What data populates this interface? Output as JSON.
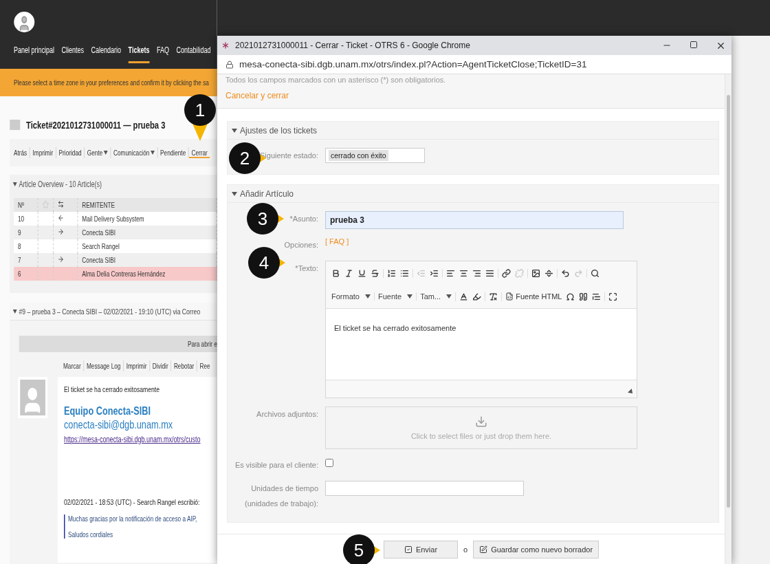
{
  "app": {
    "nav": [
      {
        "label": "Panel principal",
        "selected": false
      },
      {
        "label": "Clientes",
        "selected": false
      },
      {
        "label": "Calendario",
        "selected": false
      },
      {
        "label": "Tickets",
        "selected": true
      },
      {
        "label": "FAQ",
        "selected": false
      },
      {
        "label": "Contabilidad",
        "selected": false
      }
    ],
    "banner": "Please select a time zone in your preferences and confirm it by clicking the sa",
    "ticket_title": "Ticket#2021012731000011 — prueba 3",
    "actions": [
      {
        "label": "Atrás",
        "has_menu": false,
        "selected": false
      },
      {
        "label": "Imprimir",
        "has_menu": false,
        "selected": false
      },
      {
        "label": "Prioridad",
        "has_menu": false,
        "selected": false
      },
      {
        "label": "Gente",
        "has_menu": true,
        "selected": false
      },
      {
        "label": "Comunicación",
        "has_menu": true,
        "selected": false
      },
      {
        "label": "Pendiente",
        "has_menu": false,
        "selected": false
      },
      {
        "label": "Cerrar",
        "has_menu": false,
        "selected": true
      }
    ],
    "overview": {
      "title": "Article Overview - 10 Article(s)",
      "columns": [
        "Nº",
        "REMITENTE"
      ],
      "rows": [
        {
          "number": "10",
          "kind": "incoming",
          "sender": "Mail Delivery Subsystem",
          "selected": false
        },
        {
          "number": "9",
          "kind": "outgoing",
          "sender": "Conecta SIBI",
          "selected": false
        },
        {
          "number": "8",
          "kind": "plain",
          "sender": "Search Rangel",
          "selected": false
        },
        {
          "number": "7",
          "kind": "outgoing",
          "sender": "Conecta SIBI",
          "selected": false
        },
        {
          "number": "6",
          "kind": "plain",
          "sender": "Alma Delia Contreras Hernández",
          "selected": true
        }
      ]
    },
    "article": {
      "header": "#9 – prueba 3 – Conecta SIBI – 02/02/2021 - 19:10 (UTC) via Correo",
      "open_bar": "Para abrir e",
      "links": [
        "Marcar",
        "Message Log",
        "Imprimir",
        "Dividir",
        "Rebotar",
        "Ree"
      ],
      "text": "El ticket se ha cerrado exitosamente",
      "signature_name": "Equipo Conecta-SIBI",
      "signature_email": "conecta-sibi@dgb.unam.mx",
      "url": "https://mesa-conecta-sibi.dgb.unam.mx/otrs/custo",
      "quote_header": "02/02/2021 - 18:53 (UTC) - Search Rangel escribió:",
      "quote_lines": [
        "Muchas gracias por la notificación de acceso a AIP,",
        "Saludos cordiales"
      ]
    }
  },
  "popup": {
    "title": "2021012731000011 - Cerrar - Ticket - OTRS 6 - Google Chrome",
    "url": "mesa-conecta-sibi.dgb.unam.mx/otrs/index.pl?Action=AgentTicketClose;TicketID=31",
    "notice": "Todos los campos marcados con un asterisco (*) son obligatorios.",
    "cancel_link": "Cancelar y cerrar",
    "sections": [
      {
        "title": "Ajustes de los tickets",
        "fields": [
          {
            "kind": "select",
            "label": "Siguiente estado:",
            "value": "cerrado con éxito"
          }
        ]
      },
      {
        "title": "Añadir Artículo",
        "fields": [
          {
            "kind": "subject",
            "label": "*Asunto:",
            "value": "prueba 3",
            "focused": true
          },
          {
            "kind": "link",
            "label": "Opciones:",
            "value": "[ FAQ ]"
          },
          {
            "kind": "editor",
            "label": "*Texto:",
            "value": "El ticket se ha cerrado exitosamente",
            "toolbar": [
              [
                {
                  "kind": "bold",
                  "disabled": false
                },
                {
                  "kind": "italic",
                  "disabled": false
                },
                {
                  "kind": "underline",
                  "disabled": false
                },
                {
                  "kind": "strike",
                  "disabled": false
                }
              ],
              [
                {
                  "kind": "numbered-list",
                  "disabled": false
                },
                {
                  "kind": "bullet-list",
                  "disabled": false
                }
              ],
              [
                {
                  "kind": "outdent",
                  "disabled": true
                },
                {
                  "kind": "indent",
                  "disabled": false
                }
              ],
              [
                {
                  "kind": "align-left",
                  "disabled": false
                },
                {
                  "kind": "align-center",
                  "disabled": false
                },
                {
                  "kind": "align-right",
                  "disabled": false
                },
                {
                  "kind": "justify",
                  "disabled": false
                }
              ],
              [
                {
                  "kind": "link",
                  "disabled": false
                },
                {
                  "kind": "unlink",
                  "disabled": true
                }
              ],
              [
                {
                  "kind": "image",
                  "disabled": false
                },
                {
                  "kind": "horizontal-rule",
                  "disabled": false
                }
              ],
              [
                {
                  "kind": "undo",
                  "disabled": false
                },
                {
                  "kind": "redo",
                  "disabled": true
                }
              ],
              [
                {
                  "kind": "find",
                  "disabled": false
                }
              ]
            ],
            "toolbar2": [
              [
                {
                  "kind": "dropdown",
                  "label": "Formato"
                }
              ],
              [
                {
                  "kind": "dropdown",
                  "label": "Fuente"
                }
              ],
              [
                {
                  "kind": "dropdown",
                  "label": "Tam..."
                }
              ],
              [
                {
                  "kind": "text-color"
                },
                {
                  "kind": "background-color"
                }
              ],
              [
                {
                  "kind": "remove-format"
                }
              ],
              [
                {
                  "kind": "source",
                  "label": "Fuente HTML"
                },
                {
                  "kind": "special-char"
                },
                {
                  "kind": "blockquote"
                },
                {
                  "kind": "remove-blockquote"
                }
              ],
              [
                {
                  "kind": "maximize"
                }
              ]
            ]
          },
          {
            "kind": "upload",
            "label": "Archivos adjuntos:",
            "hint": "Click to select files or just drop them here."
          },
          {
            "kind": "checkbox",
            "label": "Es visible para el cliente:",
            "checked": false
          },
          {
            "kind": "text",
            "label": "Unidades de tiempo (unidades de trabajo):",
            "focused": false
          }
        ]
      }
    ],
    "submit": "Enviar",
    "or": "o",
    "draft": "Guardar como nuevo borrador"
  },
  "callouts": [
    {
      "label": "1"
    },
    {
      "label": "2"
    },
    {
      "label": "3"
    },
    {
      "label": "4"
    },
    {
      "label": "5"
    }
  ]
}
